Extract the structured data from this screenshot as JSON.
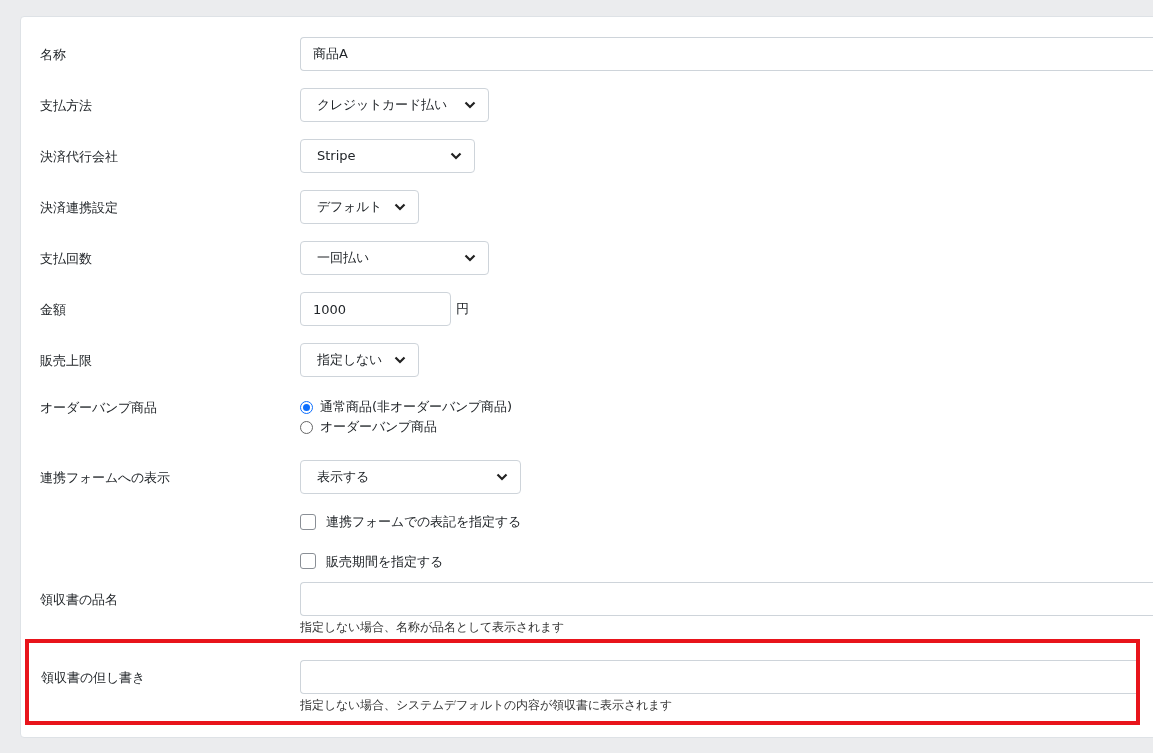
{
  "form": {
    "rows": [
      {
        "label": "名称",
        "kind": "text",
        "value": "商品A",
        "highlighted": false
      },
      {
        "label": "支払方法",
        "kind": "select",
        "value": "クレジットカード払い",
        "highlighted": false
      },
      {
        "label": "決済代行会社",
        "kind": "select",
        "value": "Stripe",
        "highlighted": false
      },
      {
        "label": "決済連携設定",
        "kind": "select",
        "value": "デフォルト",
        "highlighted": false
      },
      {
        "label": "支払回数",
        "kind": "select",
        "value": "一回払い",
        "highlighted": false
      },
      {
        "label": "金額",
        "kind": "amount",
        "value": "1000",
        "suffix": "円",
        "highlighted": false
      },
      {
        "label": "販売上限",
        "kind": "select",
        "value": "指定しない",
        "highlighted": false
      },
      {
        "label": "オーダーバンプ商品",
        "kind": "radio",
        "options": [
          {
            "label": "通常商品(非オーダーバンプ商品)",
            "selected": true
          },
          {
            "label": "オーダーバンプ商品",
            "selected": false
          }
        ],
        "highlighted": false
      },
      {
        "label": "連携フォームへの表示",
        "kind": "select",
        "value": "表示する",
        "checkboxes": [
          {
            "label": "連携フォームでの表記を指定する",
            "checked": false
          },
          {
            "label": "販売期間を指定する",
            "checked": false
          }
        ],
        "highlighted": false
      },
      {
        "label": "領収書の品名",
        "kind": "text",
        "value": "",
        "hint": "指定しない場合、名称が品名として表示されます",
        "highlighted": false
      },
      {
        "label": "領収書の但し書き",
        "kind": "text",
        "value": "",
        "hint": "指定しない場合、システムデフォルトの内容が領収書に表示されます",
        "highlighted": true
      }
    ]
  }
}
